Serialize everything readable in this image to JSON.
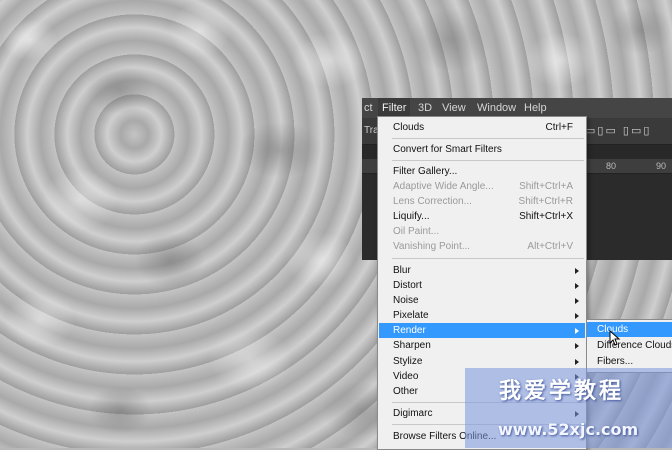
{
  "menubar": {
    "partial_left": "ct",
    "items": [
      "Filter",
      "3D",
      "View",
      "Window",
      "Help"
    ],
    "active": "Filter"
  },
  "options_bar": {
    "partial_label": "Tran"
  },
  "ruler": {
    "ticks": [
      "80",
      "90"
    ]
  },
  "filter_menu": {
    "items": [
      {
        "label": "Clouds",
        "shortcut": "Ctrl+F",
        "enabled": true
      },
      {
        "label": "Convert for Smart Filters",
        "enabled": true
      },
      {
        "label": "Filter Gallery...",
        "enabled": true
      },
      {
        "label": "Adaptive Wide Angle...",
        "shortcut": "Shift+Ctrl+A",
        "enabled": false
      },
      {
        "label": "Lens Correction...",
        "shortcut": "Shift+Ctrl+R",
        "enabled": false
      },
      {
        "label": "Liquify...",
        "shortcut": "Shift+Ctrl+X",
        "enabled": true
      },
      {
        "label": "Oil Paint...",
        "enabled": false
      },
      {
        "label": "Vanishing Point...",
        "shortcut": "Alt+Ctrl+V",
        "enabled": false
      },
      {
        "label": "Blur",
        "submenu": true
      },
      {
        "label": "Distort",
        "submenu": true
      },
      {
        "label": "Noise",
        "submenu": true
      },
      {
        "label": "Pixelate",
        "submenu": true
      },
      {
        "label": "Render",
        "submenu": true,
        "highlighted": true
      },
      {
        "label": "Sharpen",
        "submenu": true
      },
      {
        "label": "Stylize",
        "submenu": true
      },
      {
        "label": "Video",
        "submenu": true
      },
      {
        "label": "Other",
        "submenu": true
      },
      {
        "label": "Digimarc",
        "submenu": true
      },
      {
        "label": "Browse Filters Online..."
      }
    ]
  },
  "render_submenu": {
    "items": [
      "Clouds",
      "Difference Clouds",
      "Fibers..."
    ],
    "highlighted": "Clouds"
  },
  "watermark": {
    "title": "我爱学教程",
    "url": "www.52xjc.com"
  },
  "colors": {
    "highlight": "#3399ff",
    "menu_bg": "#f0f0f0",
    "ps_dark": "#2b2b2b"
  }
}
